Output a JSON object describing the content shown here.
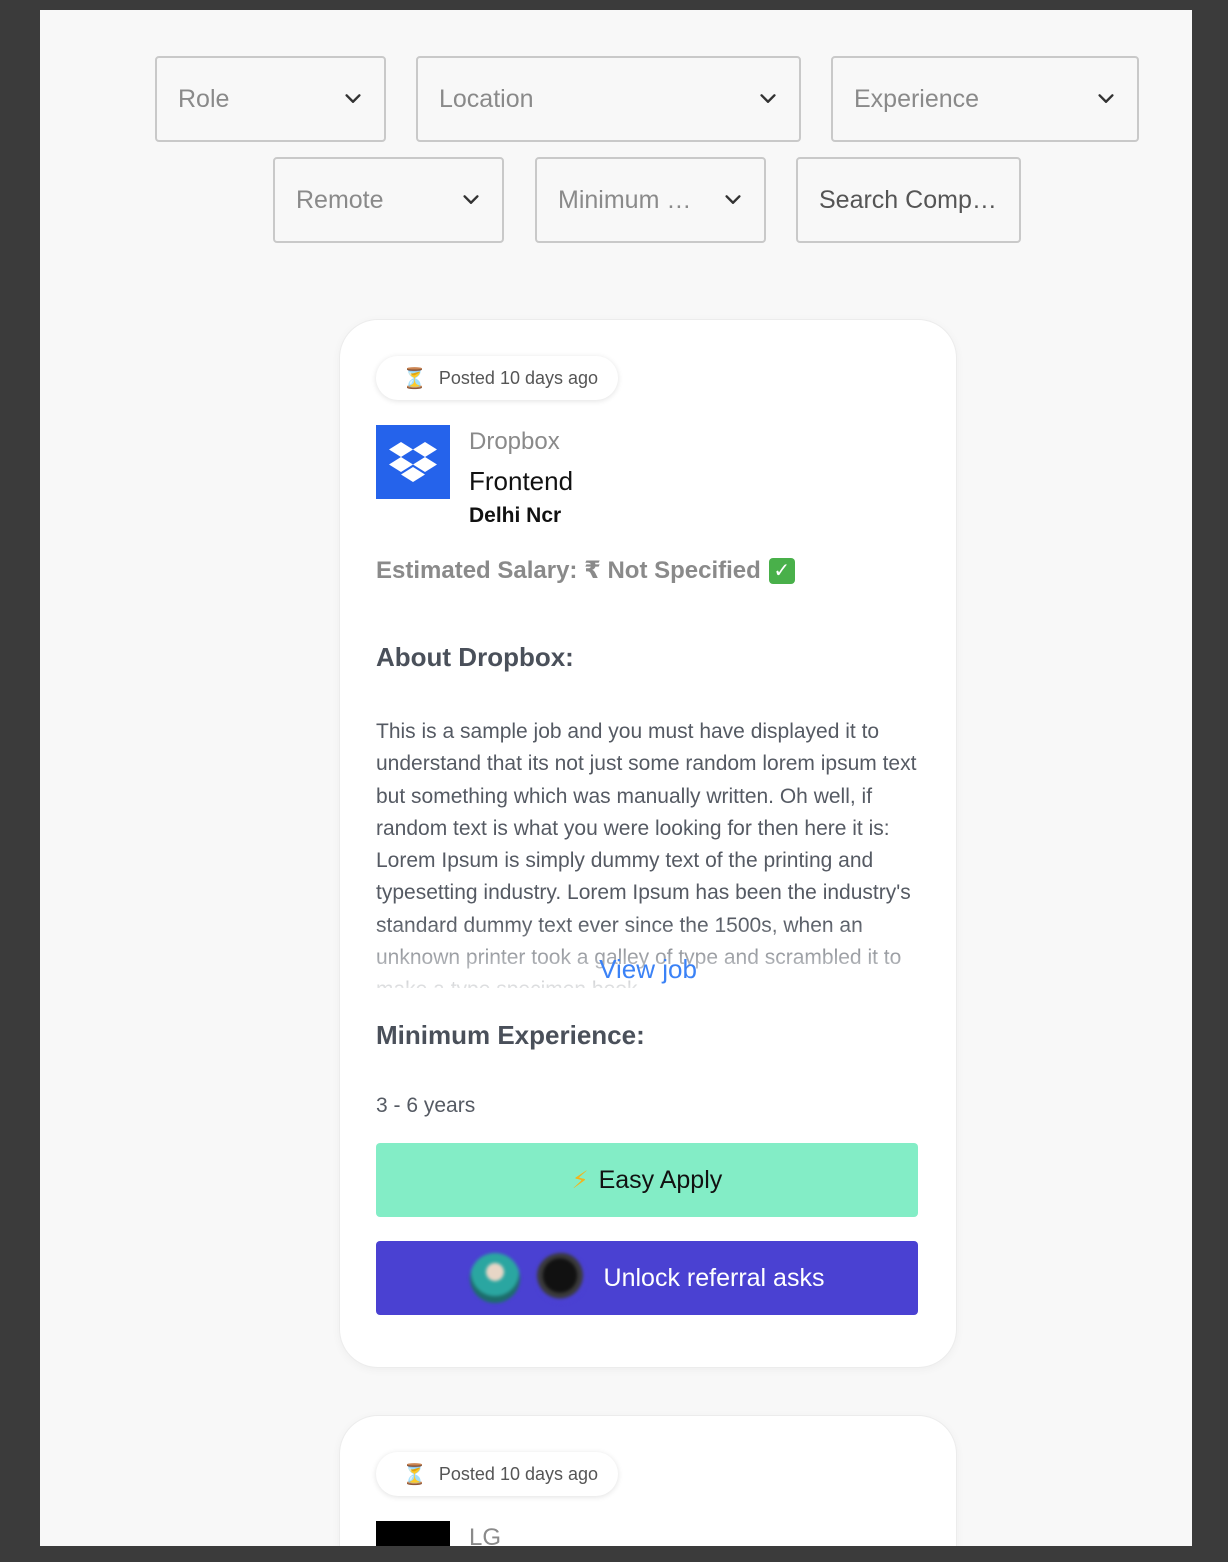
{
  "filters": {
    "role": "Role",
    "location": "Location",
    "experience": "Experience",
    "remote": "Remote",
    "minimum": "Minimum …",
    "search_placeholder": "Search Comp…"
  },
  "jobs": [
    {
      "posted": "Posted 10 days ago",
      "posted_icon": "hourglass-icon",
      "company": "Dropbox",
      "role": "Frontend",
      "location": "Delhi Ncr",
      "logo_icon": "dropbox-logo-icon",
      "logo_color": "#2563eb",
      "salary": "Estimated Salary: ₹ Not Specified",
      "about_heading": "About Dropbox:",
      "description": "This is a sample job and you must have displayed it to understand that its not just some random lorem ipsum text but something which was manually written. Oh well, if random text is what you were looking for then here it is: Lorem Ipsum is simply dummy text of the printing and typesetting industry. Lorem Ipsum has been the industry's standard dummy text ever since the 1500s, when an unknown printer took a galley of type and scrambled it to make a type specimen book.",
      "view_job": "View job",
      "experience_heading": "Minimum Experience:",
      "experience": "3 - 6 years",
      "easy_apply": "Easy Apply",
      "referral": "Unlock referral asks"
    },
    {
      "posted": "Posted 10 days ago",
      "posted_icon": "hourglass-icon",
      "company": "LG",
      "logo_color": "#000000"
    }
  ],
  "colors": {
    "easy_apply_bg": "#83edc6",
    "referral_bg": "#4a41d2",
    "link": "#3b82f6"
  }
}
